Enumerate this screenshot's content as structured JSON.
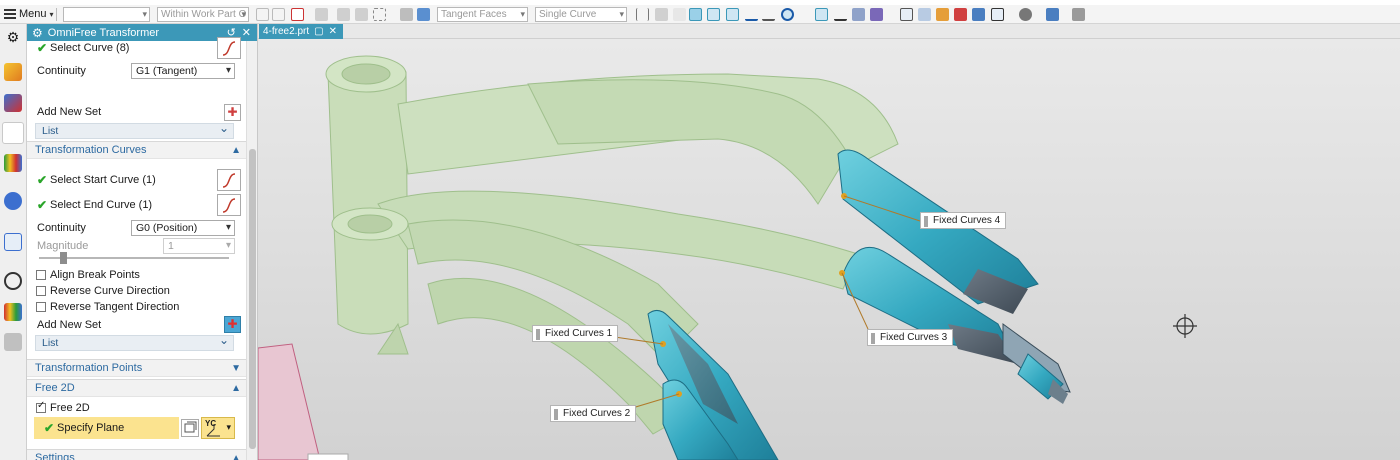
{
  "toolbar": {
    "menu_label": "Menu",
    "combo_filter": "",
    "combo_scope": "Within Work Part O",
    "combo_face_rule": "Tangent Faces",
    "combo_curve_rule": "Single Curve"
  },
  "panel": {
    "title": "OmniFree Transformer",
    "select_curve": "Select Curve (8)",
    "continuity_label": "Continuity",
    "continuity_value": "G1 (Tangent)",
    "add_new_set": "Add New Set",
    "list_label": "List",
    "transformation_curves": {
      "header": "Transformation Curves",
      "start": "Select Start Curve (1)",
      "end": "Select End Curve (1)",
      "continuity_label": "Continuity",
      "continuity_value": "G0 (Position)",
      "magnitude_label": "Magnitude",
      "magnitude_value": "1",
      "align_break_points": "Align Break Points",
      "reverse_curve_direction": "Reverse Curve Direction",
      "reverse_tangent_direction": "Reverse Tangent Direction",
      "add_new_set": "Add New Set",
      "list_label": "List"
    },
    "transformation_points_header": "Transformation Points",
    "free2d": {
      "header": "Free 2D",
      "checkbox": "Free 2D",
      "specify_plane": "Specify Plane",
      "axis_label": "YC"
    },
    "settings_header": "Settings"
  },
  "graphics": {
    "tab_label": "4-free2.prt",
    "labels": {
      "fc1": "Fixed Curves 1",
      "fc2": "Fixed Curves 2",
      "fc3": "Fixed Curves 3",
      "fc4": "Fixed Curves 4"
    }
  },
  "colors": {
    "accent": "#3c98b8",
    "frame_green": "#c7dcb8",
    "surface_teal": "#3fb0c6",
    "highlight_yellow": "#fbe38f"
  }
}
